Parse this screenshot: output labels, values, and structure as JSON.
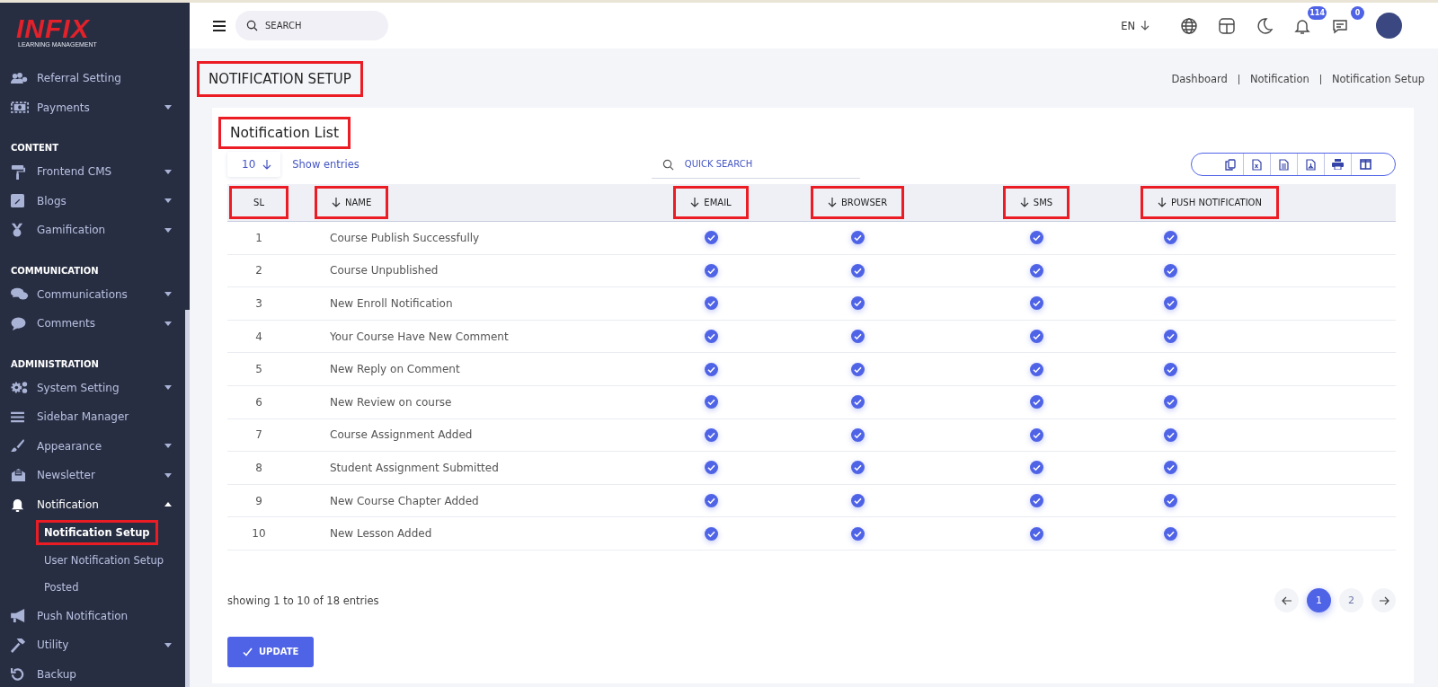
{
  "brand": {
    "logo": "INFIX",
    "tagline": "LEARNING MANAGEMENT"
  },
  "sidebar": {
    "entries": [
      {
        "kind": "item",
        "label": "Referral Setting",
        "expandable": false,
        "active": false
      },
      {
        "kind": "item",
        "label": "Payments",
        "expandable": true,
        "expanded": false,
        "active": false
      },
      {
        "kind": "section",
        "label": "CONTENT"
      },
      {
        "kind": "item",
        "label": "Frontend CMS",
        "expandable": true,
        "expanded": false,
        "active": false
      },
      {
        "kind": "item",
        "label": "Blogs",
        "expandable": true,
        "expanded": false,
        "active": false
      },
      {
        "kind": "item",
        "label": "Gamification",
        "expandable": true,
        "expanded": false,
        "active": false
      },
      {
        "kind": "section",
        "label": "COMMUNICATION"
      },
      {
        "kind": "item",
        "label": "Communications",
        "expandable": true,
        "expanded": false,
        "active": false
      },
      {
        "kind": "item",
        "label": "Comments",
        "expandable": true,
        "expanded": false,
        "active": false
      },
      {
        "kind": "section",
        "label": "ADMINISTRATION"
      },
      {
        "kind": "item",
        "label": "System Setting",
        "expandable": true,
        "expanded": false,
        "active": false
      },
      {
        "kind": "item",
        "label": "Sidebar Manager",
        "expandable": false,
        "active": false
      },
      {
        "kind": "item",
        "label": "Appearance",
        "expandable": true,
        "expanded": false,
        "active": false
      },
      {
        "kind": "item",
        "label": "Newsletter",
        "expandable": true,
        "expanded": false,
        "active": false
      },
      {
        "kind": "item",
        "label": "Notification",
        "expandable": true,
        "expanded": true,
        "active": true,
        "children": [
          {
            "label": "Notification Setup",
            "selected": true,
            "highlighted": true
          },
          {
            "label": "User Notification Setup",
            "selected": false,
            "highlighted": false
          },
          {
            "label": "Posted",
            "selected": false,
            "highlighted": false
          }
        ]
      },
      {
        "kind": "item",
        "label": "Push Notification",
        "expandable": false,
        "active": false
      },
      {
        "kind": "item",
        "label": "Utility",
        "expandable": true,
        "expanded": false,
        "active": false
      },
      {
        "kind": "item",
        "label": "Backup",
        "expandable": false,
        "active": false
      }
    ]
  },
  "topbar": {
    "search": {
      "placeholder": "SEARCH"
    },
    "language": "EN",
    "notification_count": "114",
    "message_count": "0"
  },
  "page": {
    "title": "NOTIFICATION SETUP",
    "title_highlighted": true,
    "breadcrumb": [
      "Dashboard",
      "Notification",
      "Notification Setup"
    ]
  },
  "card": {
    "title": "Notification List",
    "title_highlighted": true,
    "page_size": "10",
    "show_entries": "Show entries",
    "quick_search": {
      "placeholder": "QUICK SEARCH"
    },
    "table": {
      "columns": [
        {
          "label": "SL",
          "sortable": false,
          "highlighted": true
        },
        {
          "label": "NAME",
          "sortable": true,
          "highlighted": true
        },
        {
          "label": "EMAIL",
          "sortable": true,
          "highlighted": true
        },
        {
          "label": "BROWSER",
          "sortable": true,
          "highlighted": true
        },
        {
          "label": "SMS",
          "sortable": true,
          "highlighted": true
        },
        {
          "label": "PUSH NOTIFICATION",
          "sortable": true,
          "highlighted": true
        }
      ],
      "rows": [
        {
          "sl": "1",
          "name": "Course Publish Successfully",
          "email": true,
          "browser": true,
          "sms": true,
          "push": true
        },
        {
          "sl": "2",
          "name": "Course Unpublished",
          "email": true,
          "browser": true,
          "sms": true,
          "push": true
        },
        {
          "sl": "3",
          "name": "New Enroll Notification",
          "email": true,
          "browser": true,
          "sms": true,
          "push": true
        },
        {
          "sl": "4",
          "name": "Your Course Have New Comment",
          "email": true,
          "browser": true,
          "sms": true,
          "push": true
        },
        {
          "sl": "5",
          "name": "New Reply on Comment",
          "email": true,
          "browser": true,
          "sms": true,
          "push": true
        },
        {
          "sl": "6",
          "name": "New Review on course",
          "email": true,
          "browser": true,
          "sms": true,
          "push": true
        },
        {
          "sl": "7",
          "name": "Course Assignment Added",
          "email": true,
          "browser": true,
          "sms": true,
          "push": true
        },
        {
          "sl": "8",
          "name": "Student Assignment Submitted",
          "email": true,
          "browser": true,
          "sms": true,
          "push": true
        },
        {
          "sl": "9",
          "name": "New Course Chapter Added",
          "email": true,
          "browser": true,
          "sms": true,
          "push": true
        },
        {
          "sl": "10",
          "name": "New Lesson Added",
          "email": true,
          "browser": true,
          "sms": true,
          "push": true
        }
      ]
    },
    "summary": "showing 1 to 10 of 18 entries",
    "pages": [
      {
        "label": "1",
        "selected": true
      },
      {
        "label": "2",
        "selected": false
      }
    ],
    "update_button": "UPDATE"
  }
}
